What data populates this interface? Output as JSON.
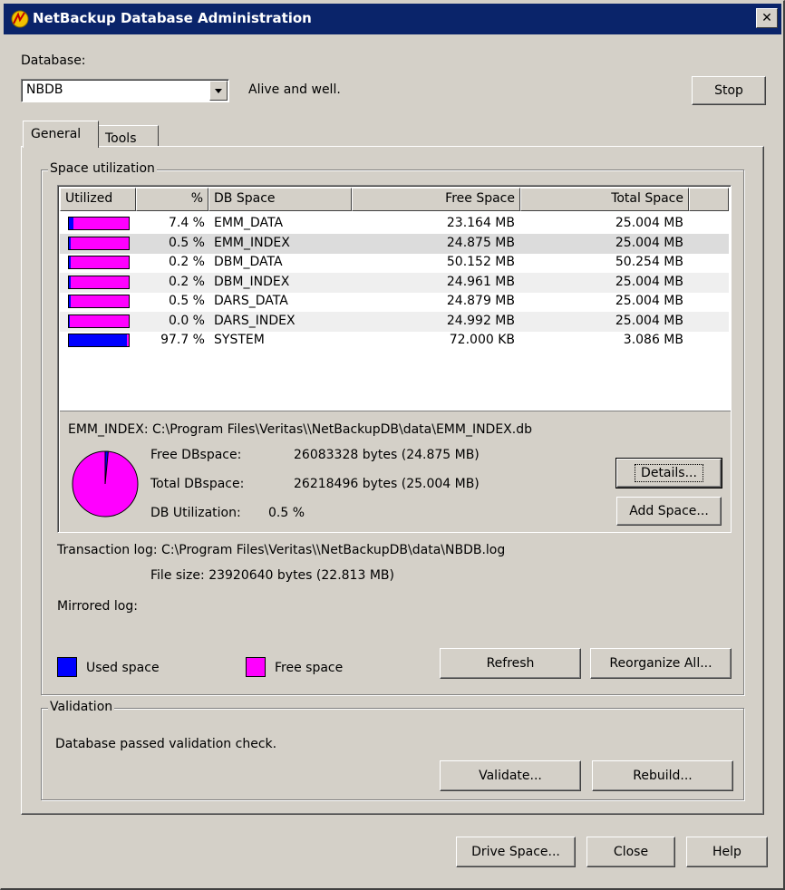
{
  "window": {
    "title": "NetBackup Database Administration"
  },
  "database": {
    "label": "Database:",
    "selected": "NBDB",
    "status": "Alive and well.",
    "stop_label": "Stop"
  },
  "tabs": [
    {
      "label": "General"
    },
    {
      "label": "Tools"
    }
  ],
  "space": {
    "group_label": "Space utilization",
    "columns": [
      "Utilized",
      "%",
      "DB Space",
      "Free Space",
      "Total Space"
    ],
    "rows": [
      {
        "utilized": 0.074,
        "percent": "7.4 %",
        "db_space": "EMM_DATA",
        "free": "23.164 MB",
        "total": "25.004 MB"
      },
      {
        "utilized": 0.005,
        "percent": "0.5 %",
        "db_space": "EMM_INDEX",
        "free": "24.875 MB",
        "total": "25.004 MB"
      },
      {
        "utilized": 0.002,
        "percent": "0.2 %",
        "db_space": "DBM_DATA",
        "free": "50.152 MB",
        "total": "50.254 MB"
      },
      {
        "utilized": 0.002,
        "percent": "0.2 %",
        "db_space": "DBM_INDEX",
        "free": "24.961 MB",
        "total": "25.004 MB"
      },
      {
        "utilized": 0.005,
        "percent": "0.5 %",
        "db_space": "DARS_DATA",
        "free": "24.879 MB",
        "total": "25.004 MB"
      },
      {
        "utilized": 0.0,
        "percent": "0.0 %",
        "db_space": "DARS_INDEX",
        "free": "24.992 MB",
        "total": "25.004 MB"
      },
      {
        "utilized": 0.977,
        "percent": "97.7 %",
        "db_space": "SYSTEM",
        "free": "72.000 KB",
        "total": "3.086 MB"
      }
    ],
    "detail": {
      "path": "EMM_INDEX: C:\\Program Files\\Veritas\\\\NetBackupDB\\data\\EMM_INDEX.db",
      "free_label": "Free DBspace:",
      "free_value": "26083328 bytes (24.875 MB)",
      "total_label": "Total DBspace:",
      "total_value": "26218496 bytes (25.004 MB)",
      "util_label": "DB Utilization:",
      "util_value": "0.5 %",
      "util_fraction": 0.005,
      "details_label": "Details...",
      "add_space_label": "Add Space..."
    },
    "transaction_log": "Transaction log: C:\\Program Files\\Veritas\\\\NetBackupDB\\data\\NBDB.log",
    "file_size": "File size: 23920640 bytes (22.813 MB)",
    "mirrored_log": "Mirrored log:",
    "legend_used": "Used space",
    "legend_free": "Free space",
    "refresh_label": "Refresh",
    "reorganize_label": "Reorganize All..."
  },
  "validation": {
    "group_label": "Validation",
    "message": "Database passed validation check.",
    "validate_label": "Validate...",
    "rebuild_label": "Rebuild..."
  },
  "footer": {
    "drive_space_label": "Drive Space...",
    "close_label": "Close",
    "help_label": "Help"
  },
  "colors": {
    "used": "#0000ff",
    "free": "#ff00ff",
    "titlebar": "#0a246a",
    "face": "#d4d0c8"
  },
  "icons": {
    "app": "netbackup-app-icon",
    "close": "close-icon",
    "dropdown": "chevron-down-icon"
  }
}
